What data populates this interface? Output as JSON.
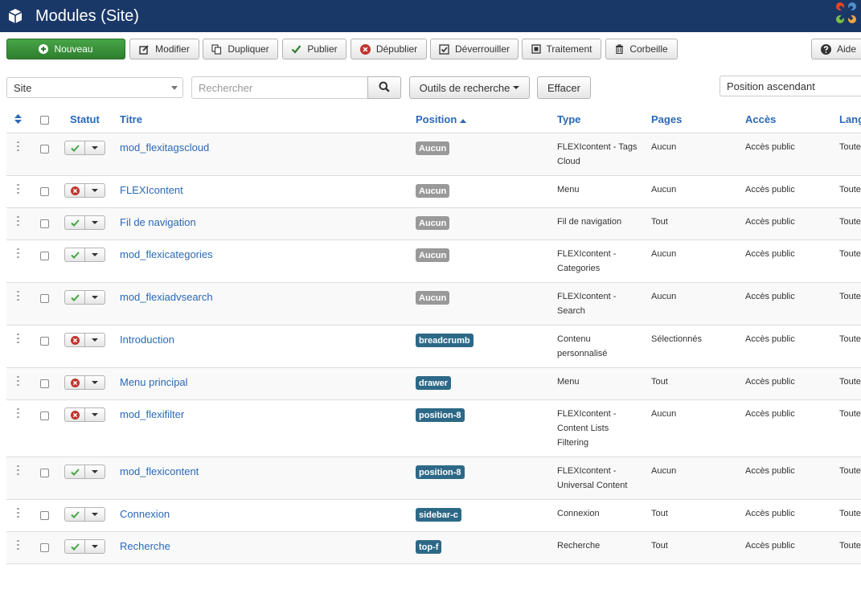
{
  "header": {
    "title": "Modules (Site)"
  },
  "toolbar": {
    "new": "Nouveau",
    "edit": "Modifier",
    "duplicate": "Dupliquer",
    "publish": "Publier",
    "unpublish": "Dépublier",
    "checkin": "Déverrouiller",
    "batch": "Traitement",
    "trash": "Corbeille",
    "help": "Aide"
  },
  "filters": {
    "client": "Site",
    "search_placeholder": "Rechercher",
    "search_tools": "Outils de recherche",
    "clear": "Effacer",
    "ordering": "Position ascendant"
  },
  "columns": {
    "status": "Statut",
    "title": "Titre",
    "position": "Position",
    "type": "Type",
    "pages": "Pages",
    "access": "Accès",
    "language": "Lang"
  },
  "rows": [
    {
      "title": "mod_flexitagscloud",
      "published": true,
      "position": "Aucun",
      "type": [
        "FLEXIcontent - Tags",
        "Cloud"
      ],
      "pages": "Aucun",
      "access": "Accès public",
      "language": "Toute"
    },
    {
      "title": "FLEXIcontent",
      "published": false,
      "position": "Aucun",
      "type": [
        "Menu"
      ],
      "pages": "Aucun",
      "access": "Accès public",
      "language": "Toute"
    },
    {
      "title": "Fil de navigation",
      "published": true,
      "position": "Aucun",
      "type": [
        "Fil de navigation"
      ],
      "pages": "Tout",
      "access": "Accès public",
      "language": "Toute"
    },
    {
      "title": "mod_flexicategories",
      "published": true,
      "position": "Aucun",
      "type": [
        "FLEXIcontent -",
        "Categories"
      ],
      "pages": "Aucun",
      "access": "Accès public",
      "language": "Toute"
    },
    {
      "title": "mod_flexiadvsearch",
      "published": true,
      "position": "Aucun",
      "type": [
        "FLEXIcontent -",
        "Search"
      ],
      "pages": "Aucun",
      "access": "Accès public",
      "language": "Toute"
    },
    {
      "title": "Introduction",
      "published": false,
      "position": "breadcrumb",
      "type": [
        "Contenu",
        "personnalisé"
      ],
      "pages": "Sélectionnés",
      "access": "Accès public",
      "language": "Toute"
    },
    {
      "title": "Menu principal",
      "published": false,
      "position": "drawer",
      "type": [
        "Menu"
      ],
      "pages": "Tout",
      "access": "Accès public",
      "language": "Toute"
    },
    {
      "title": "mod_flexifilter",
      "published": false,
      "position": "position-8",
      "type": [
        "FLEXIcontent -",
        "Content Lists",
        "Filtering"
      ],
      "pages": "Aucun",
      "access": "Accès public",
      "language": "Toute"
    },
    {
      "title": "mod_flexicontent",
      "published": true,
      "position": "position-8",
      "type": [
        "FLEXIcontent -",
        "Universal Content"
      ],
      "pages": "Aucun",
      "access": "Accès public",
      "language": "Toute"
    },
    {
      "title": "Connexion",
      "published": true,
      "position": "sidebar-c",
      "type": [
        "Connexion"
      ],
      "pages": "Tout",
      "access": "Accès public",
      "language": "Toute"
    },
    {
      "title": "Recherche",
      "published": true,
      "position": "top-f",
      "type": [
        "Recherche"
      ],
      "pages": "Tout",
      "access": "Accès public",
      "language": "Toute"
    }
  ],
  "colors": {
    "header_bg": "#1a3867",
    "link": "#2a69b8",
    "new_button": "#46a546",
    "badge_none": "#999999",
    "badge_position": "#2d6987",
    "published": "#46a546",
    "unpublished": "#bd362f"
  },
  "icons": {
    "header": "cube-icon",
    "logo": "joomla-logo-icon",
    "new": "plus-circle-icon",
    "edit": "edit-icon",
    "duplicate": "copy-icon",
    "publish": "check-icon",
    "unpublish": "times-circle-icon",
    "checkin": "checkbox-icon",
    "batch": "square-icon",
    "trash": "trash-icon",
    "help": "question-circle-icon",
    "search": "search-icon"
  }
}
